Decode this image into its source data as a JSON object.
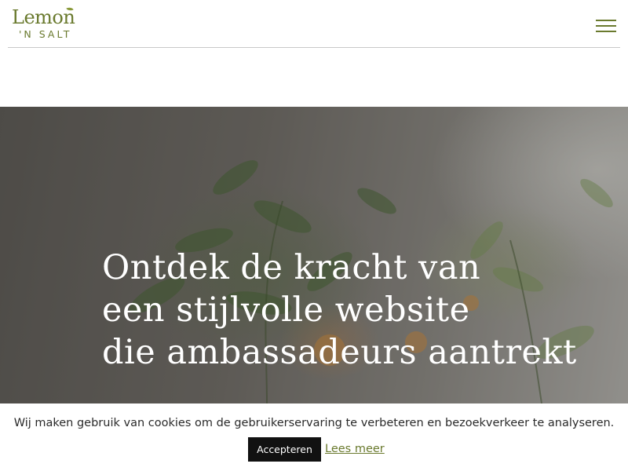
{
  "header": {
    "logo": {
      "word": "Lemon",
      "sub": "'N SALT",
      "icon": "lemon-leaf-icon"
    },
    "menu_icon": "hamburger-menu-icon"
  },
  "hero": {
    "title_lines": [
      "Ontdek de kracht van",
      "een stijlvolle website",
      "die ambassadeurs aantrekt"
    ]
  },
  "cookie_bar": {
    "message": "Wij maken gebruik van cookies om de gebruikerservaring te verbeteren en bezoekverkeer te analyseren.",
    "accept_label": "Accepteren",
    "more_label": "Lees meer"
  },
  "colors": {
    "brand_olive": "#6a7a2e",
    "button_black": "#111111",
    "text_dark": "#2a2a2a"
  }
}
